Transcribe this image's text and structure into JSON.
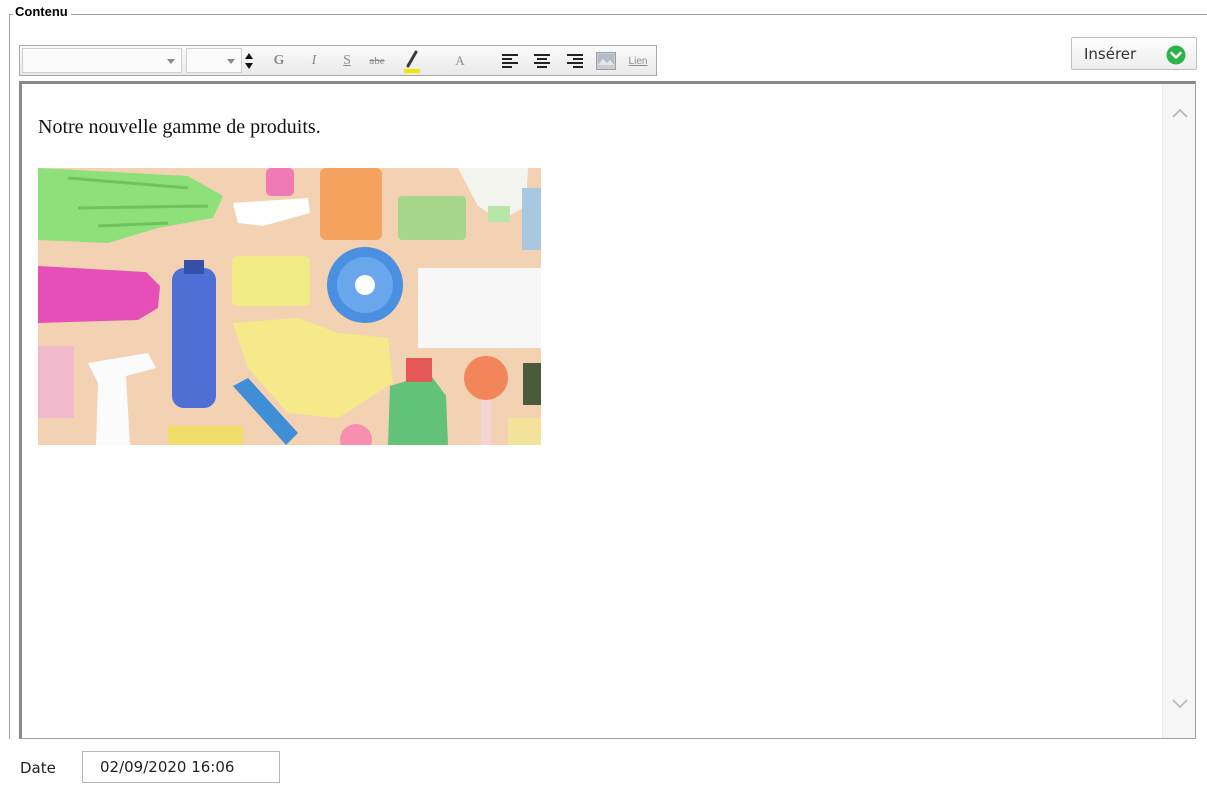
{
  "section": {
    "title": "Contenu"
  },
  "toolbar": {
    "bold_label": "G",
    "italic_label": "I",
    "underline_label": "S",
    "strike_label": "abe",
    "font_color_label": "A",
    "link_label": "Lien",
    "highlight_color": "#f2e600"
  },
  "insert": {
    "label": "Insérer",
    "icon": "chevron-down-circle-icon",
    "icon_color": "#2db34a"
  },
  "editor": {
    "text": "Notre nouvelle gamme de produits.",
    "image_icon": "cleaning-products-photo"
  },
  "date": {
    "label": "Date",
    "value": "02/09/2020 16:06"
  }
}
